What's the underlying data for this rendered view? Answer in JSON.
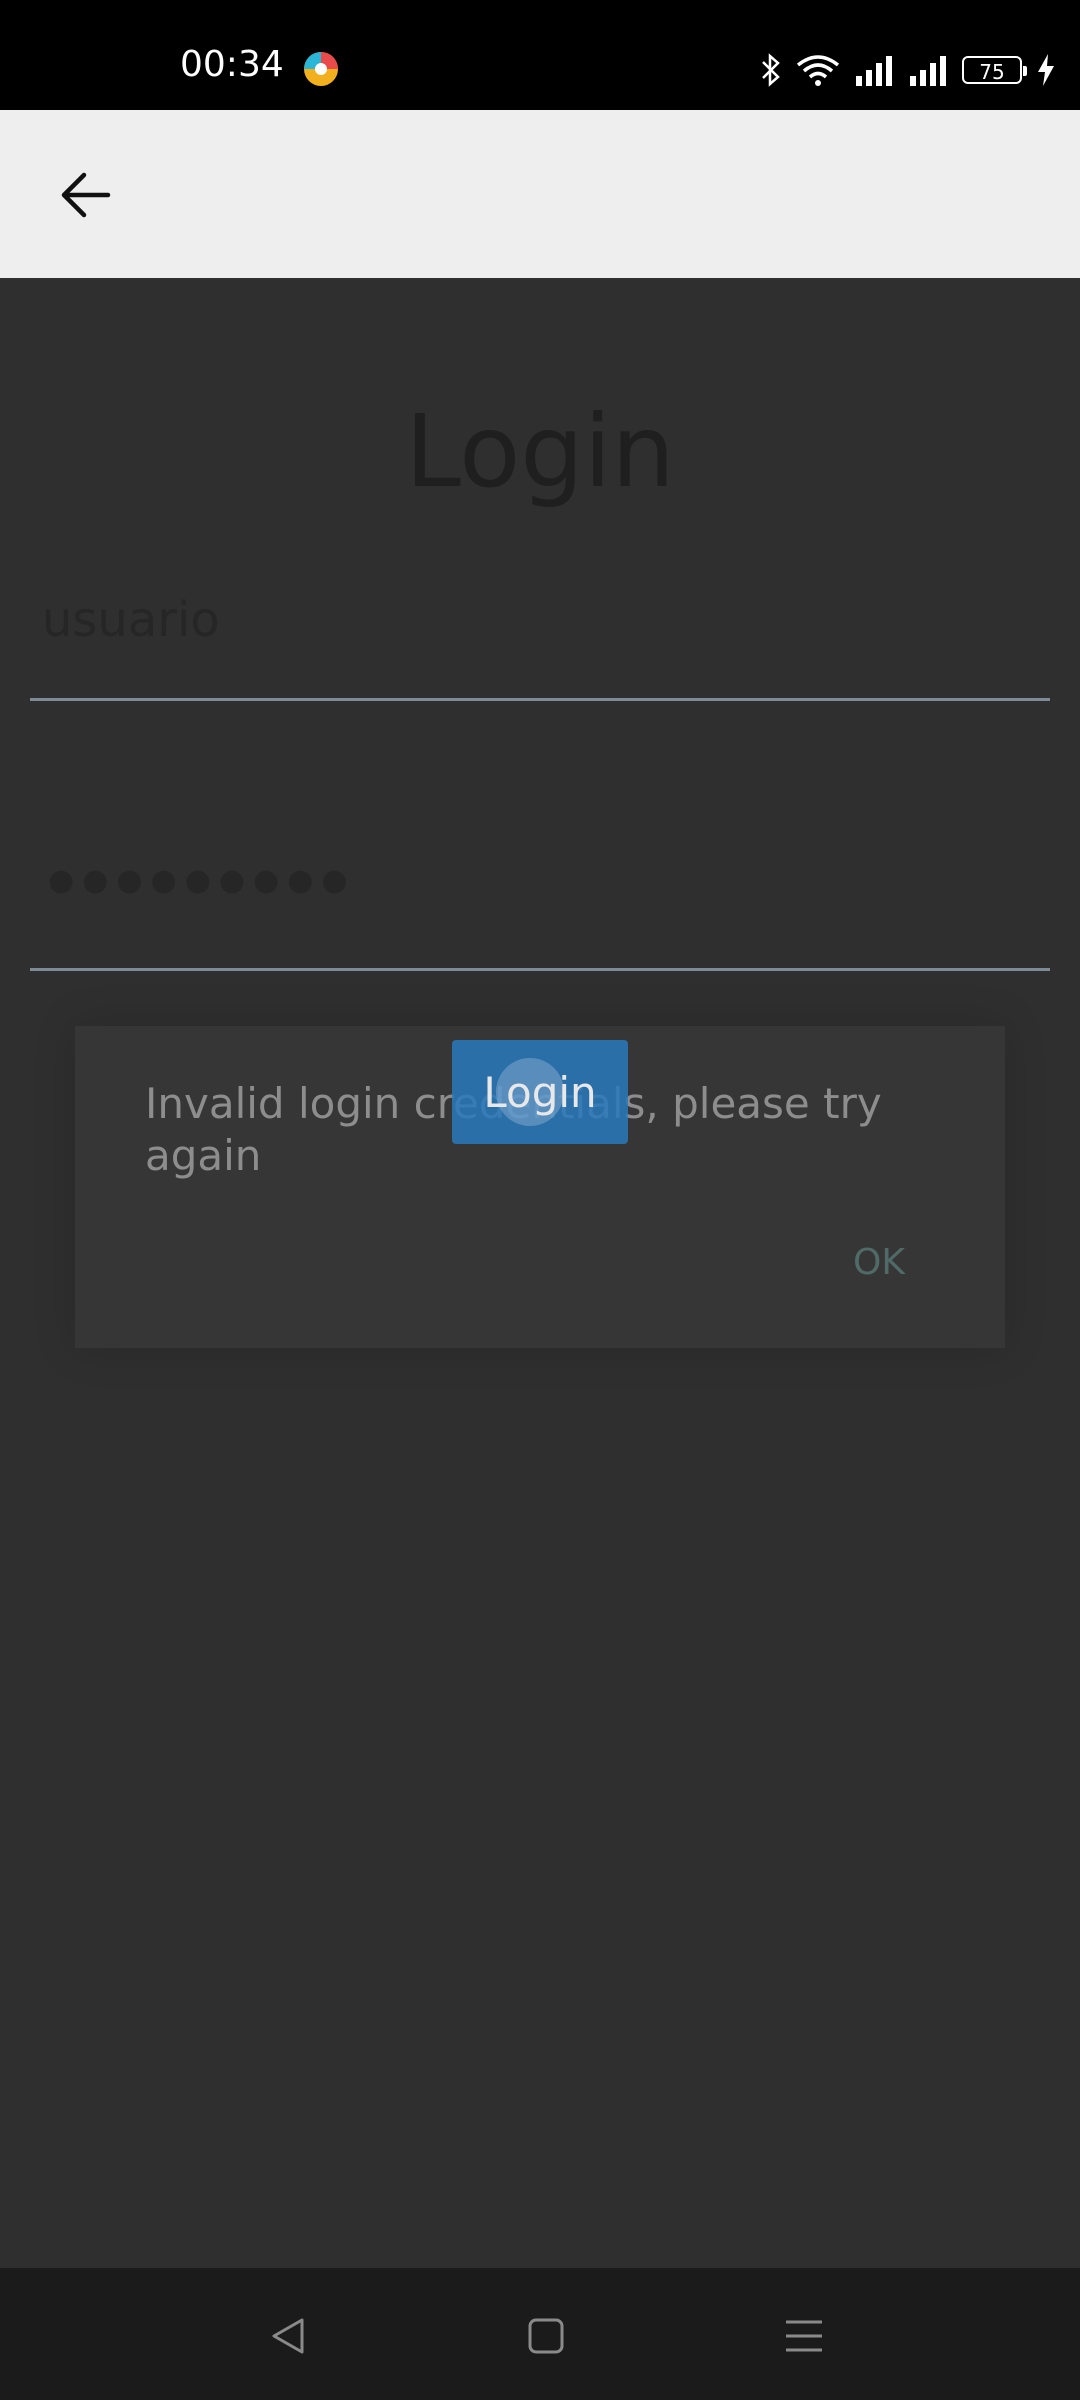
{
  "status_bar": {
    "time": "00:34",
    "battery_level": "75",
    "icons": [
      "app-icon",
      "bluetooth-icon",
      "wifi-icon",
      "signal-icon",
      "signal-icon",
      "battery-icon",
      "charging-icon"
    ]
  },
  "app_bar": {
    "back_icon": "arrow-left-icon"
  },
  "login": {
    "title": "Login",
    "username_value": "usuario",
    "password_masked": "●●●●●●●●●",
    "button_label": "Login"
  },
  "dialog": {
    "message": "Invalid login credentials, please try again",
    "ok_label": "OK"
  },
  "nav_bar": {
    "back": "triangle-back-icon",
    "home": "square-home-icon",
    "recents": "menu-lines-icon"
  },
  "colors": {
    "accent_button": "#2979BD",
    "dialog_ok": "#4F6A67",
    "background": "#2F2F2F"
  }
}
